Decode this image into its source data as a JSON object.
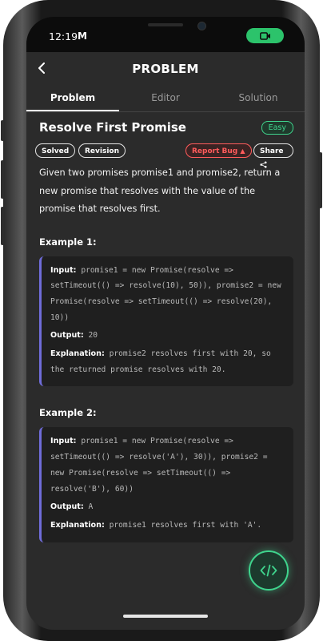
{
  "status_bar": {
    "time": "12:19",
    "notification_icon": "M"
  },
  "header": {
    "title": "PROBLEM"
  },
  "tabs": [
    {
      "label": "Problem",
      "active": true
    },
    {
      "label": "Editor",
      "active": false
    },
    {
      "label": "Solution",
      "active": false
    }
  ],
  "problem": {
    "title": "Resolve First Promise",
    "difficulty": "Easy",
    "tags": [
      "Solved",
      "Revision"
    ],
    "report_bug_label": "Report Bug",
    "share_label": "Share",
    "description": "Given two promises promise1 and promise2, return a new promise that resolves with the value of the promise that resolves first."
  },
  "examples": [
    {
      "title": "Example 1:",
      "input_label": "Input:",
      "input": "promise1 = new Promise(resolve => setTimeout(() => resolve(10), 50)), promise2 = new Promise(resolve => setTimeout(() => resolve(20), 10))",
      "output_label": "Output:",
      "output": "20",
      "explanation_label": "Explanation:",
      "explanation": "promise2 resolves first with 20, so the returned promise resolves with 20."
    },
    {
      "title": "Example 2:",
      "input_label": "Input:",
      "input": "promise1 = new Promise(resolve => setTimeout(() => resolve('A'), 30)), promise2 = new Promise(resolve => setTimeout(() => resolve('B'), 60))",
      "output_label": "Output:",
      "output": "A",
      "explanation_label": "Explanation:",
      "explanation": "promise1 resolves first with 'A'."
    }
  ],
  "colors": {
    "accent_green": "#3fd48d",
    "bug_red": "#ff5b5b",
    "example_border": "#6f6cd9"
  },
  "icons": {
    "back": "chevron-left-icon",
    "share": "share-icon",
    "bug": "bug-icon",
    "fab": "code-icon",
    "camera": "video-camera-icon"
  }
}
